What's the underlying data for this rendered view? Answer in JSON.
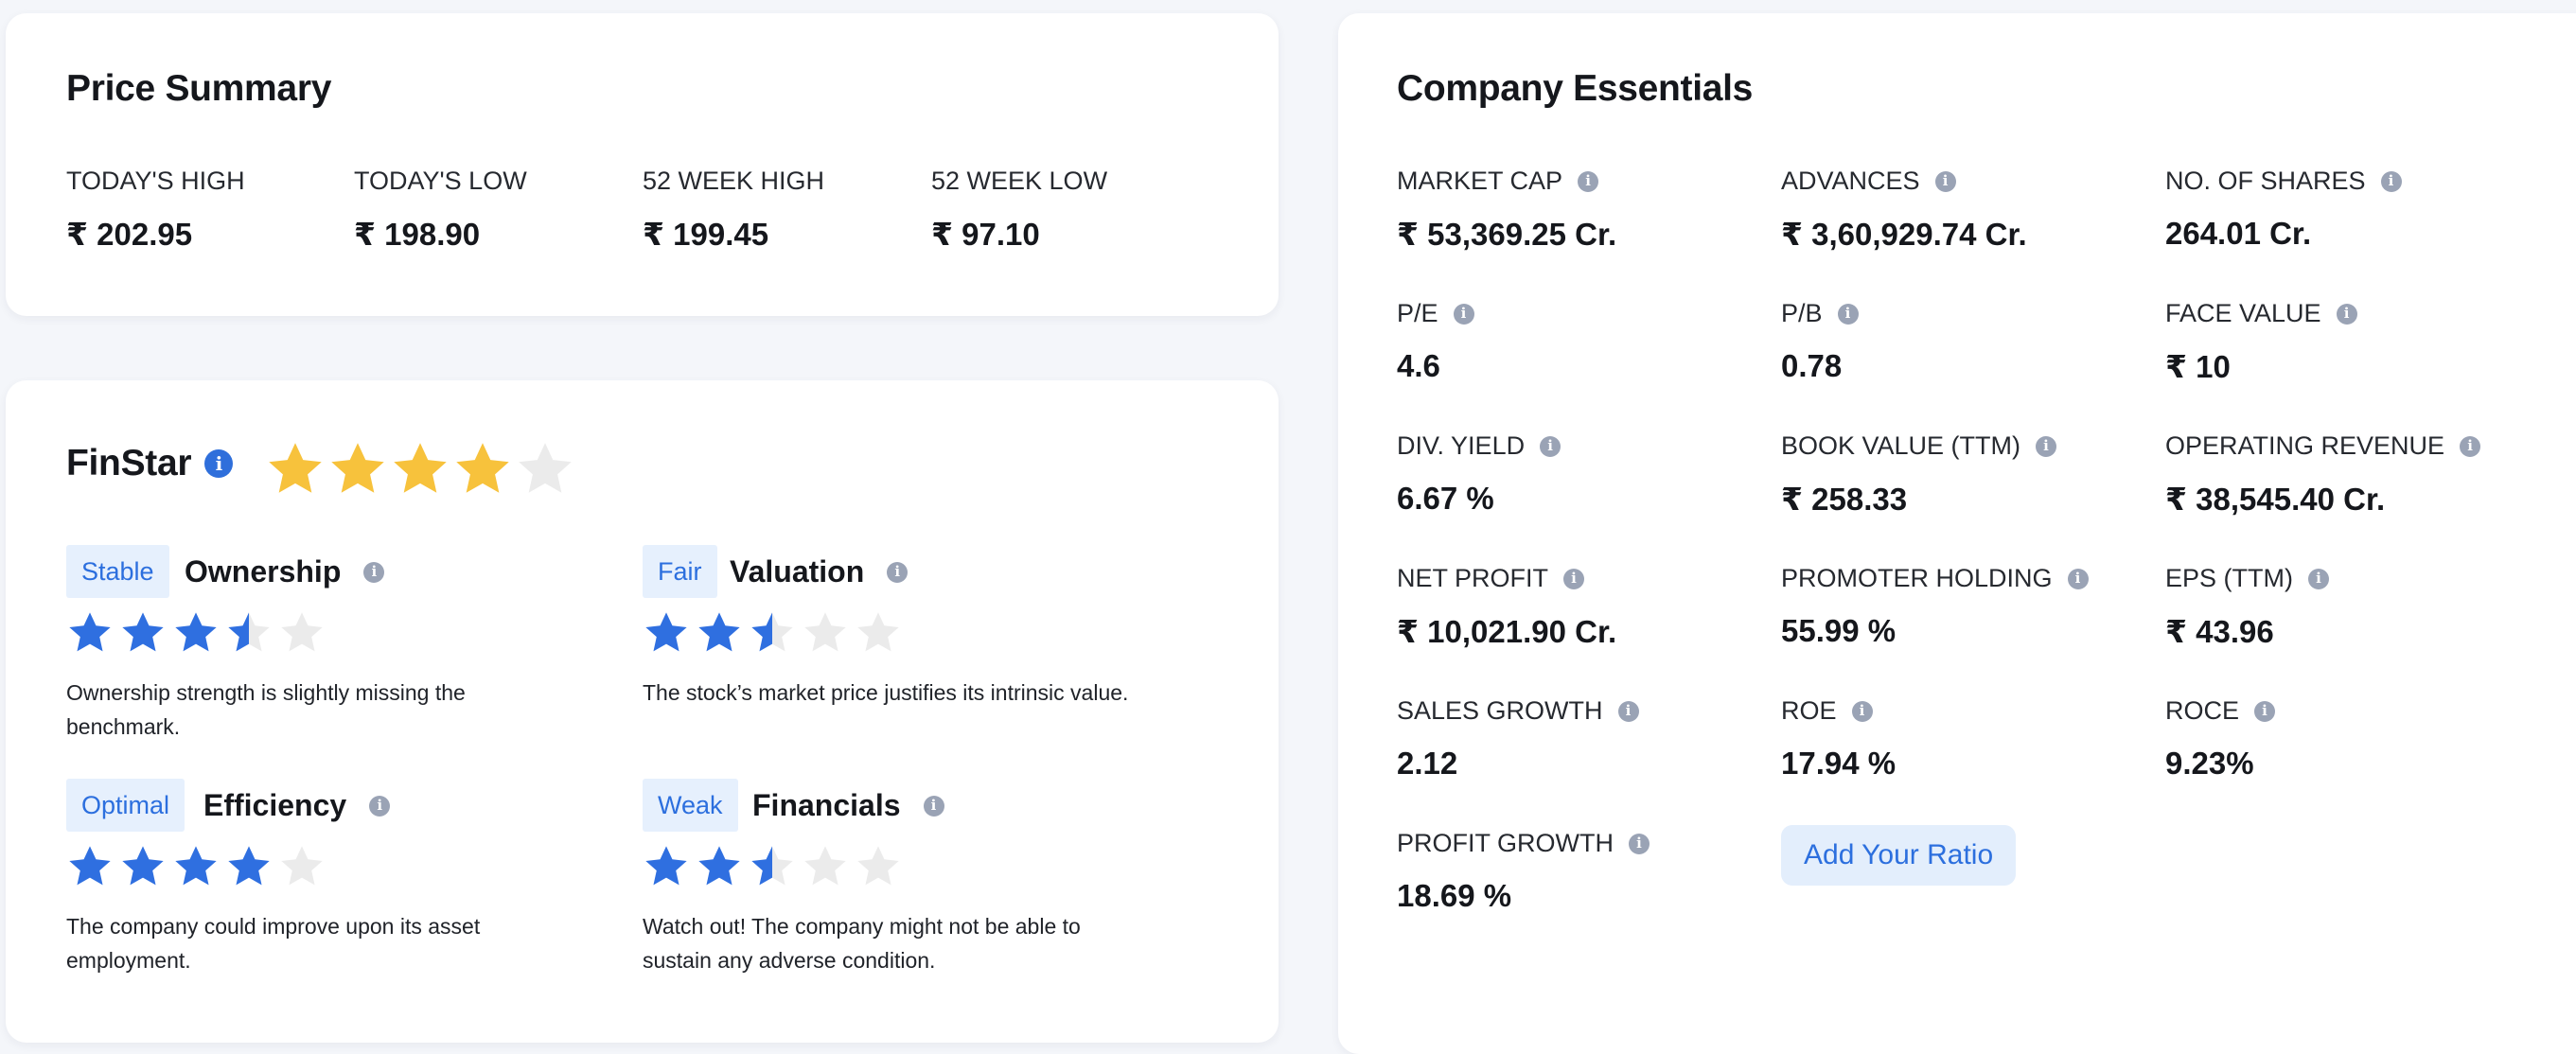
{
  "price_summary": {
    "title": "Price Summary",
    "items": [
      {
        "label": "TODAY'S HIGH",
        "value": "₹ 202.95"
      },
      {
        "label": "TODAY'S LOW",
        "value": "₹ 198.90"
      },
      {
        "label": "52 WEEK HIGH",
        "value": "₹ 199.45"
      },
      {
        "label": "52 WEEK LOW",
        "value": "₹ 97.10"
      }
    ]
  },
  "finstar": {
    "title": "FinStar",
    "rating": 4,
    "rating_max": 5,
    "star_color": "#f7c23c",
    "categories": [
      {
        "badge": "Stable",
        "name": "Ownership",
        "rating": 3.5,
        "description": "Ownership strength is slightly missing the benchmark."
      },
      {
        "badge": "Fair",
        "name": "Valuation",
        "rating": 2.5,
        "description": "The stock’s market price justifies its intrinsic value."
      },
      {
        "badge": "Optimal",
        "name": "Efficiency",
        "rating": 4,
        "description": "The company could improve upon its asset employment."
      },
      {
        "badge": "Weak",
        "name": "Financials",
        "rating": 2.5,
        "description": "Watch out! The company might not be able to sustain any adverse condition."
      }
    ],
    "category_star_color": "#2f6fe0",
    "empty_star_color": "#ebebeb"
  },
  "essentials": {
    "title": "Company Essentials",
    "items": [
      {
        "label": "MARKET CAP",
        "value": "₹ 53,369.25 Cr.",
        "info": true
      },
      {
        "label": "ADVANCES",
        "value": "₹ 3,60,929.74 Cr.",
        "info": true
      },
      {
        "label": "NO. OF SHARES",
        "value": "264.01 Cr.",
        "info": true
      },
      {
        "label": "P/E",
        "value": "4.6",
        "info": true
      },
      {
        "label": "P/B",
        "value": "0.78",
        "info": true
      },
      {
        "label": "FACE VALUE",
        "value": "₹ 10",
        "info": true
      },
      {
        "label": "DIV. YIELD",
        "value": "6.67 %",
        "info": true
      },
      {
        "label": "BOOK VALUE (TTM)",
        "value": "₹  258.33",
        "info": true
      },
      {
        "label": "OPERATING REVENUE",
        "value": "₹ 38,545.40 Cr.",
        "info": true
      },
      {
        "label": "NET PROFIT",
        "value": "₹ 10,021.90 Cr.",
        "info": true
      },
      {
        "label": "PROMOTER HOLDING",
        "value": "55.99 %",
        "info": true
      },
      {
        "label": "EPS (TTM)",
        "value": "₹  43.96",
        "info": true
      },
      {
        "label": "SALES GROWTH",
        "value": "2.12",
        "info": true
      },
      {
        "label": "ROE",
        "value": "17.94 %",
        "info": true
      },
      {
        "label": "ROCE",
        "value": "9.23%",
        "info": true
      },
      {
        "label": "PROFIT GROWTH",
        "value": "18.69 %",
        "info": true
      }
    ],
    "add_ratio_label": "Add Your Ratio"
  },
  "icons": {
    "info": "info-icon",
    "star": "star-icon"
  }
}
